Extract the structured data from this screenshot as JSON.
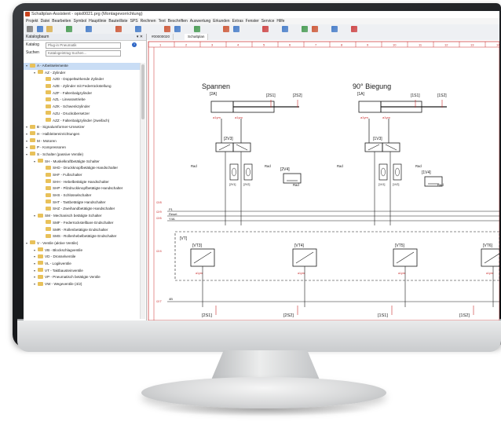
{
  "window": {
    "title": "Schaltplan-Assistent - opisl0021.prg (Montagevorrichtung)"
  },
  "menu": [
    "Projekt",
    "Datei",
    "Bearbeiten",
    "Symbol",
    "Hauptlinie",
    "Bauteilliste",
    "SPS",
    "Rechnen",
    "Text",
    "Beschriften",
    "Auswertung",
    "Erkunden",
    "Extras",
    "Fenster",
    "Service",
    "Hilfe"
  ],
  "left_panel": {
    "header": "Katalogbaum",
    "close_glyph": "▾ ✕",
    "catalog_label": "Katalog",
    "catalog_value": "Plug-in Pneumatik",
    "search_label": "Suchen",
    "search_placeholder": "Katalogeintrag Suchen..."
  },
  "tree": [
    {
      "label": "A - Arbeitselemente",
      "level": 0,
      "folder": true,
      "selected": true
    },
    {
      "label": "AZ - Zylinder",
      "level": 1,
      "folder": true
    },
    {
      "label": "AZD - Doppeltwirkende Zylinder",
      "level": 2,
      "folder": true
    },
    {
      "label": "AZE - Zylinder mit Federrückstellung",
      "level": 2,
      "folder": true
    },
    {
      "label": "AZF - Faltenbalgzylinder",
      "level": 2,
      "folder": true
    },
    {
      "label": "AZL - Linearantriebe",
      "level": 2,
      "folder": true
    },
    {
      "label": "AZK - Schwenkzylinder",
      "level": 2,
      "folder": true
    },
    {
      "label": "AZU - Druckübersetzer",
      "level": 2,
      "folder": true
    },
    {
      "label": "AZZ - Faltenbalgzylinder (zweifach)",
      "level": 2,
      "folder": true
    },
    {
      "label": "B - Signalumformer-Umsetzer",
      "level": 0,
      "folder": true
    },
    {
      "label": "H - Halbleitereinrichtungen",
      "level": 0,
      "folder": true
    },
    {
      "label": "M - Motoren",
      "level": 0,
      "folder": true
    },
    {
      "label": "P - Kompressoren",
      "level": 0,
      "folder": true
    },
    {
      "label": "S - Schalter (passive Ventile)",
      "level": 0,
      "folder": true
    },
    {
      "label": "SH - Muskelkraftbetätigte Schalter",
      "level": 1,
      "folder": true
    },
    {
      "label": "SHD - Druckknopfbetätigte Handschalter",
      "level": 2,
      "folder": true
    },
    {
      "label": "SHF - Fußschalter",
      "level": 2,
      "folder": true
    },
    {
      "label": "SHH - Hebelbetätigte Handschalter",
      "level": 2,
      "folder": true
    },
    {
      "label": "SHP - Pilzdruckknopfbetätigte Handschalter",
      "level": 2,
      "folder": true
    },
    {
      "label": "SHS - Schlüsselschalter",
      "level": 2,
      "folder": true
    },
    {
      "label": "SHT - Tastbetätigte Handschalter",
      "level": 2,
      "folder": true
    },
    {
      "label": "SHZ - Zweihandbetätigte Handschalter",
      "level": 2,
      "folder": true
    },
    {
      "label": "SM - Mechanisch betätigte Schalter",
      "level": 1,
      "folder": true
    },
    {
      "label": "SMF - Federrückstellbare Endschalter",
      "level": 2,
      "folder": true
    },
    {
      "label": "SMR - Rollenbetätigte Endschalter",
      "level": 2,
      "folder": true
    },
    {
      "label": "SMS - Rollenhebelbetätigte Endschalter",
      "level": 2,
      "folder": true
    },
    {
      "label": "V - Ventile (aktive Ventile)",
      "level": 0,
      "folder": true
    },
    {
      "label": "VB - Blockschlagventile",
      "level": 1,
      "folder": true
    },
    {
      "label": "VD - Drosselventile",
      "level": 1,
      "folder": true
    },
    {
      "label": "VL - Logikventile",
      "level": 1,
      "folder": true
    },
    {
      "label": "VT - Taktbausteinventile",
      "level": 1,
      "folder": true
    },
    {
      "label": "VP - Pneumatisch betätigte Ventile",
      "level": 1,
      "folder": true
    },
    {
      "label": "VW - Wegeventile (4/2)",
      "level": 1,
      "folder": true
    }
  ],
  "tabs": [
    "#00000020",
    "Schaltplan"
  ],
  "schematic": {
    "titles": [
      "Spannen",
      "90° Biegung"
    ],
    "cylinder_tags": [
      "[2A]",
      "[1A]"
    ],
    "sensor_tags_top": [
      "[2S1]",
      "[2S2]",
      "[1S1]",
      "[1S2]"
    ],
    "valve_tags": [
      "[2V3]",
      "[1V3]",
      "[2V4]",
      "[1V4]",
      "[2V1]",
      "[2V2]",
      "[1V1]",
      "[1V2]"
    ],
    "island_tag": "[VT]",
    "island_modules": [
      "[VT3]",
      "[VT4]",
      "[VT5]",
      "[VT6]"
    ],
    "bottom_tags": [
      "[2S1]",
      "[2S2]",
      "[1S1]",
      "[1S2]"
    ],
    "rail_labels": [
      "P1",
      "Reset",
      "Y4A",
      "Y4B"
    ],
    "line_refs": [
      "/2/8",
      "/2/9",
      "/2/6",
      "/2/4",
      "/2/7"
    ],
    "small_labels": [
      "Rad",
      "Rad",
      "Rad",
      "Rad",
      "Rad",
      "Rad"
    ],
    "port_label": "a1ym",
    "bottom_rail_label": "4B"
  },
  "colors": {
    "accent": "#c9421c",
    "wire": "#1a1a1a",
    "frame_red": "#c92a2a",
    "tree_select": "#c9ddf5"
  }
}
